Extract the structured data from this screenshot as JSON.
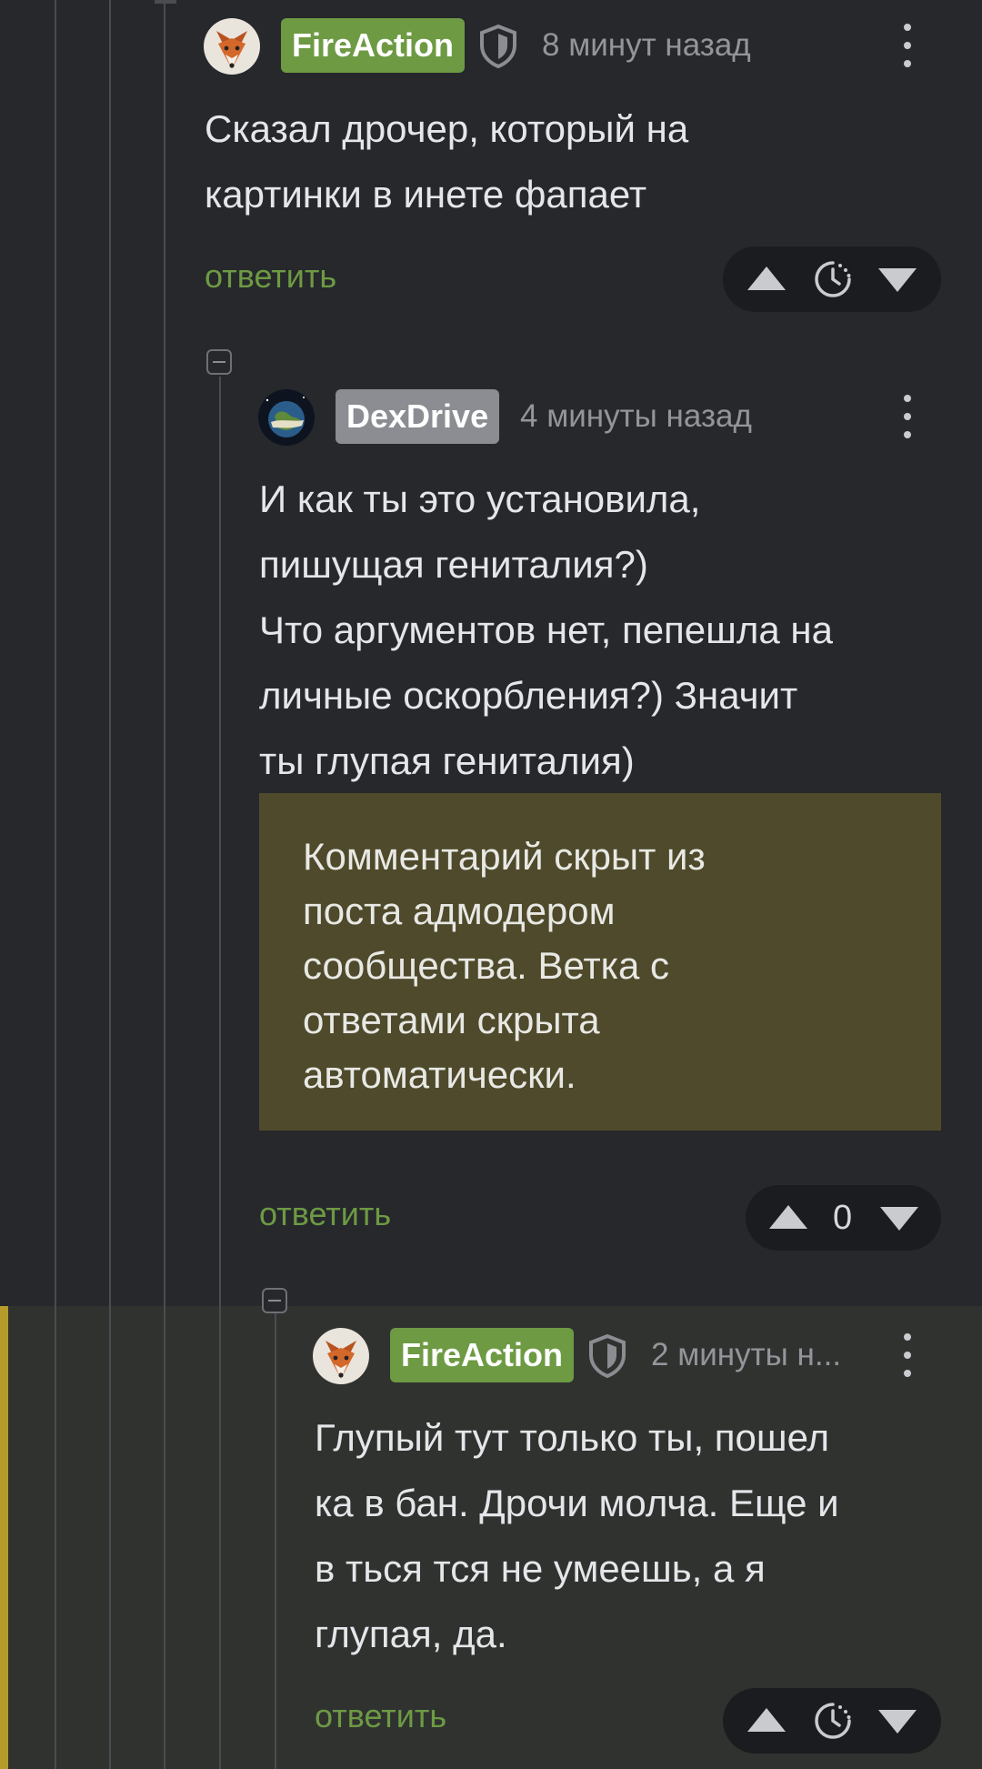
{
  "colors": {
    "background": "#26282c",
    "highlight_background": "#303230",
    "highlight_bar": "#b59b2a",
    "username_green": "#6d9a43",
    "username_gray": "#8b8d92",
    "reply_link": "#6d9a43",
    "hidden_notice_bg": "#4e4a2b"
  },
  "comments": [
    {
      "username": "FireAction",
      "time": "8 минут назад",
      "text": "Сказал дрочер, который на\nкартинки в инете фапает",
      "reply_label": "ответить",
      "avatar_icon": "fox-avatar-icon",
      "badge_icon": "shield-icon",
      "vote_middle_icon": "timer-icon"
    },
    {
      "username": "DexDrive",
      "time": "4 минуты назад",
      "text": "И как ты это установила,\nпишущая гениталия?)\nЧто аргументов нет, пепешла на\nличные оскорбления?) Значит\nты глупая гениталия)",
      "hidden_notice": "Комментарий скрыт из\nпоста адмодером\nсообщества. Ветка с\nответами скрыта\nавтоматически.",
      "reply_label": "ответить",
      "rating": "0",
      "avatar_icon": "earth-avatar-icon"
    },
    {
      "username": "FireAction",
      "time": "2 минуты н...",
      "text": "Глупый тут только ты, пошел\nка в бан. Дрочи молча. Еще и\nв ться тся не умеешь, а я\nглупая, да.",
      "reply_label": "ответить",
      "avatar_icon": "fox-avatar-icon",
      "badge_icon": "shield-icon",
      "vote_middle_icon": "timer-icon"
    }
  ]
}
